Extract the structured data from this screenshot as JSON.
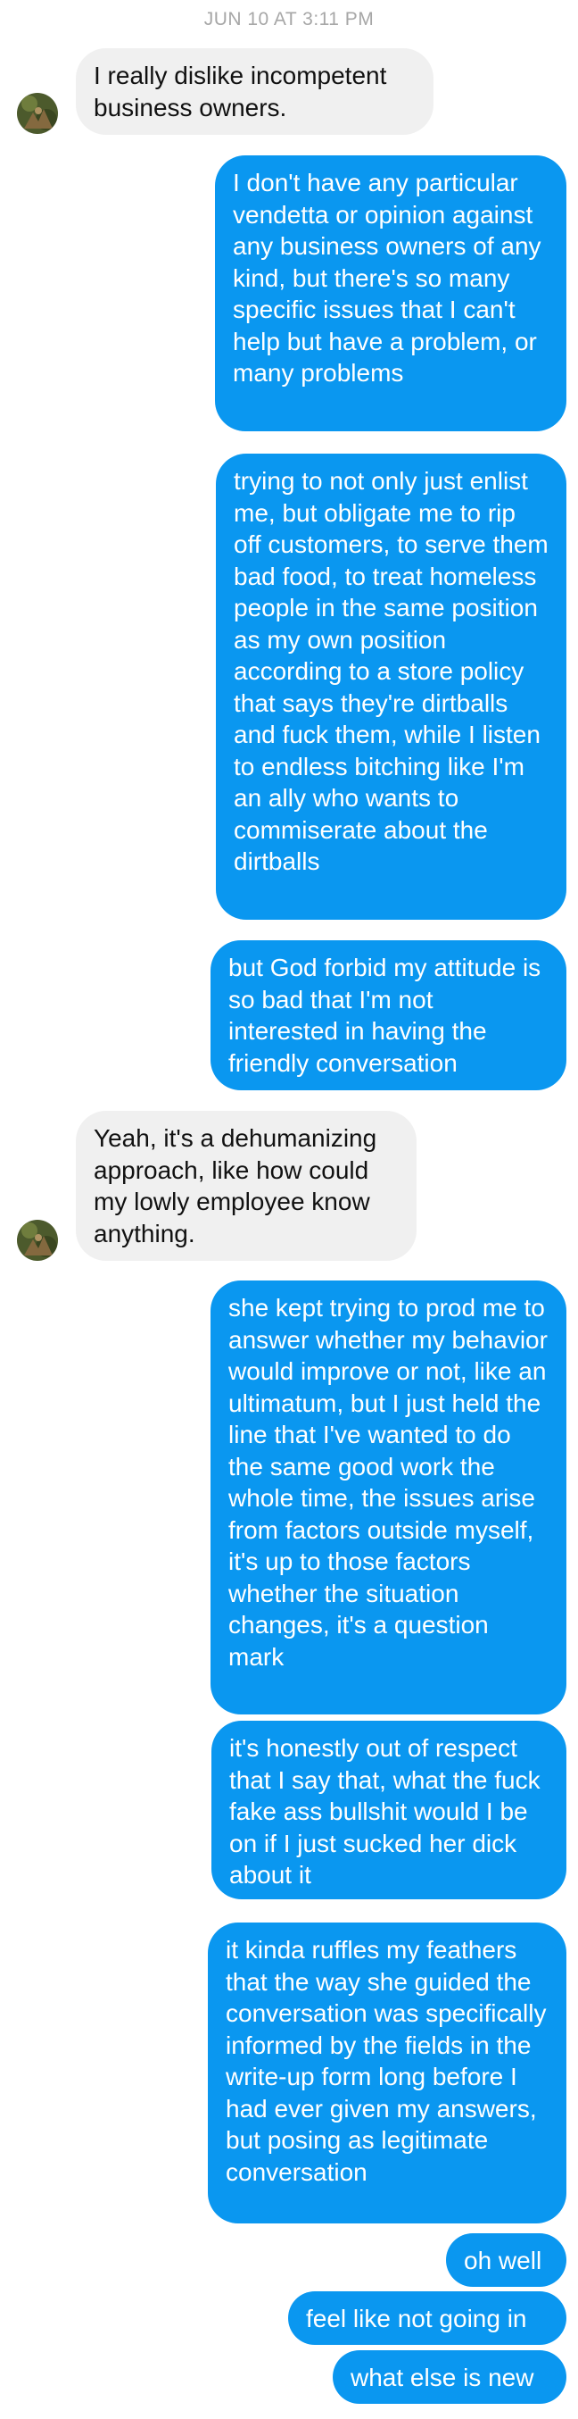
{
  "header": {
    "timestamp": "JUN 10 AT 3:11 PM"
  },
  "colors": {
    "outgoing_bubble": "#0a97f0",
    "incoming_bubble": "#f0f0f0",
    "timestamp": "#a7a7a7"
  },
  "messages": [
    {
      "sender": "them",
      "text": "I really dislike incompetent business owners."
    },
    {
      "sender": "me",
      "text": "I don't have any particular vendetta or opinion against any business owners of any kind, but there's so many specific issues that I can't help but have a problem, or many problems"
    },
    {
      "sender": "me",
      "text": "trying to not only just enlist me, but obligate me to rip off customers, to serve them bad food, to treat homeless people in the same position as my own position according to a store policy that says they're dirtballs and fuck them, while I listen to endless bitching like I'm an ally who wants to commiserate about the dirtballs"
    },
    {
      "sender": "me",
      "text": "but God forbid my attitude is so bad that I'm not interested in having the friendly conversation"
    },
    {
      "sender": "them",
      "text": "Yeah, it's a dehumanizing approach, like how could my lowly employee know anything."
    },
    {
      "sender": "me",
      "text": "she kept trying to prod me to answer whether my behavior would improve or not, like an ultimatum, but I just held the line that I've wanted to do the same good work the whole time, the issues arise from factors outside myself, it's up to those factors whether the situation changes, it's a question mark"
    },
    {
      "sender": "me",
      "text": "it's honestly out of respect that I say that, what the fuck fake ass bullshit would I be on if I just sucked her dick about it"
    },
    {
      "sender": "me",
      "text": "it kinda ruffles my feathers that the way she guided the conversation was specifically informed by the fields in the write-up form long before I had ever given my answers, but posing as legitimate conversation"
    },
    {
      "sender": "me",
      "text": "oh well"
    },
    {
      "sender": "me",
      "text": "feel like not going in"
    },
    {
      "sender": "me",
      "text": "what else is new"
    }
  ]
}
